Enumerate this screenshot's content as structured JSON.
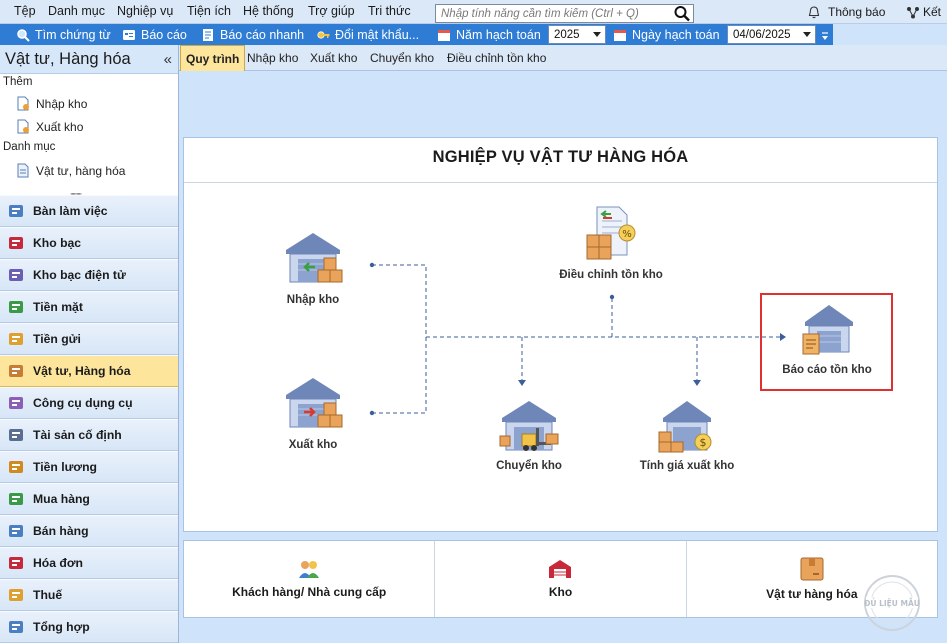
{
  "menu": {
    "items": [
      "Tệp",
      "Danh mục",
      "Nghiệp vụ",
      "Tiện ích",
      "Hệ thống",
      "Trợ giúp",
      "Tri thức"
    ],
    "search_placeholder": "Nhập tính năng cần tìm kiếm (Ctrl + Q)",
    "notification_label": "Thông báo",
    "logout_label": "Kết"
  },
  "toolbar": {
    "find_voucher": "Tìm chứng từ",
    "report": "Báo cáo",
    "quick_report": "Báo cáo nhanh",
    "change_password": "Đổi mật khẩu...",
    "fiscal_year_label": "Năm hạch toán",
    "fiscal_year_value": "2025",
    "posting_date_label": "Ngày hạch toán",
    "posting_date_value": "04/06/2025"
  },
  "sidebar": {
    "title": "Vật tư, Hàng hóa",
    "collapse_glyph": "«",
    "add_label": "Thêm",
    "add_items": [
      "Nhập kho",
      "Xuất kho"
    ],
    "catalog_label": "Danh mục",
    "catalog_items": [
      "Vật tư, hàng hóa"
    ],
    "nav": [
      {
        "label": "Bàn làm việc",
        "icon": "desk-icon"
      },
      {
        "label": "Kho bạc",
        "icon": "treasury-icon"
      },
      {
        "label": "Kho bạc điện tử",
        "icon": "e-treasury-icon"
      },
      {
        "label": "Tiền mặt",
        "icon": "cash-icon"
      },
      {
        "label": "Tiền gửi",
        "icon": "deposit-icon"
      },
      {
        "label": "Vật tư, Hàng hóa",
        "icon": "goods-icon",
        "active": true
      },
      {
        "label": "Công cụ dụng cụ",
        "icon": "tools-icon"
      },
      {
        "label": "Tài sản cố định",
        "icon": "fixed-asset-icon"
      },
      {
        "label": "Tiền lương",
        "icon": "payroll-icon"
      },
      {
        "label": "Mua hàng",
        "icon": "cart-icon"
      },
      {
        "label": "Bán hàng",
        "icon": "sales-icon"
      },
      {
        "label": "Hóa đơn",
        "icon": "invoice-icon"
      },
      {
        "label": "Thuế",
        "icon": "tax-icon"
      },
      {
        "label": "Tổng hợp",
        "icon": "summary-icon"
      }
    ]
  },
  "tabs": [
    "Quy trình",
    "Nhập kho",
    "Xuất kho",
    "Chuyển kho",
    "Điều chỉnh tồn kho"
  ],
  "workflow": {
    "title": "NGHIỆP VỤ VẬT TƯ HÀNG HÓA",
    "nodes": {
      "import": "Nhập kho",
      "export": "Xuất kho",
      "adjust": "Điều chỉnh tồn kho",
      "transfer": "Chuyển kho",
      "pricing": "Tính giá xuất kho",
      "report": "Báo cáo tồn kho"
    }
  },
  "shortcuts": [
    "Khách hàng/ Nhà cung cấp",
    "Kho",
    "Vật tư hàng hóa"
  ],
  "watermark_text": "ĐỦ LIỆU MẪU",
  "colors": {
    "toolbar": "#2e7cd4",
    "active": "#fde59c",
    "highlight": "#e03030",
    "background": "#cfe3fb"
  }
}
